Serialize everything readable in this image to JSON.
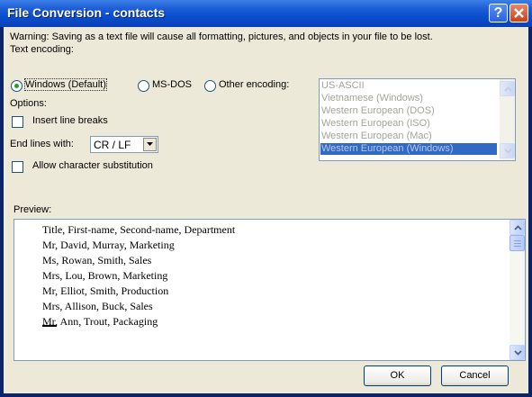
{
  "window": {
    "title": "File Conversion - contacts",
    "help_glyph": "?"
  },
  "dialog": {
    "warning": "Warning: Saving as a text file will cause all formatting, pictures, and objects in your file to be lost.",
    "text_encoding_label": "Text encoding:",
    "encoding_options": [
      {
        "label": "Windows (Default)",
        "checked": true
      },
      {
        "label": "MS-DOS",
        "checked": false
      },
      {
        "label": "Other encoding:",
        "checked": false
      }
    ],
    "encoding_list": {
      "items": [
        "US-ASCII",
        "Vietnamese (Windows)",
        "Western European (DOS)",
        "Western European (ISO)",
        "Western European (Mac)",
        "Western European (Windows)"
      ],
      "selected": "Western European (Windows)"
    },
    "options_label": "Options:",
    "insert_line_breaks": {
      "label": "Insert line breaks",
      "checked": false
    },
    "end_lines_with": {
      "label": "End lines with:",
      "value": "CR / LF"
    },
    "allow_char_substitution": {
      "label": "Allow character substitution",
      "checked": false
    },
    "preview_label": "Preview:",
    "preview_lines": [
      "Title, First-name, Second-name, Department",
      "Mr, David, Murray, Marketing",
      "Ms, Rowan, Smith, Sales",
      "Mrs, Lou, Brown, Marketing",
      "Mr, Elliot, Smith, Production",
      "Mrs, Allison, Buck, Sales",
      "Mr, Ann, Trout, Packaging"
    ],
    "ok_label": "OK",
    "cancel_label": "Cancel"
  },
  "colors": {
    "titlebar": "#0b4fcf",
    "dialog_bg": "#ece9d8",
    "selection": "#316ac5"
  }
}
